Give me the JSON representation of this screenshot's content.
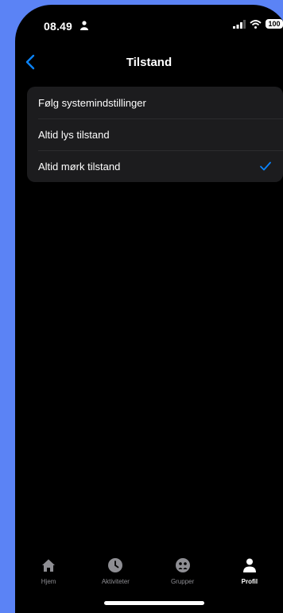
{
  "status": {
    "time": "08.49",
    "battery": "100"
  },
  "header": {
    "title": "Tilstand",
    "back_icon": "chevron-left-icon"
  },
  "options": [
    {
      "label": "Følg systemindstillinger",
      "selected": false
    },
    {
      "label": "Altid lys tilstand",
      "selected": false
    },
    {
      "label": "Altid mørk tilstand",
      "selected": true
    }
  ],
  "tabs": [
    {
      "label": "Hjem",
      "icon": "home-icon",
      "active": false
    },
    {
      "label": "Aktiviteter",
      "icon": "clock-icon",
      "active": false
    },
    {
      "label": "Grupper",
      "icon": "groups-icon",
      "active": false
    },
    {
      "label": "Profil",
      "icon": "person-icon",
      "active": true
    }
  ],
  "colors": {
    "accent": "#0a84ff",
    "background": "#000000",
    "group": "#1c1c1e",
    "frame": "#5b83f5"
  }
}
